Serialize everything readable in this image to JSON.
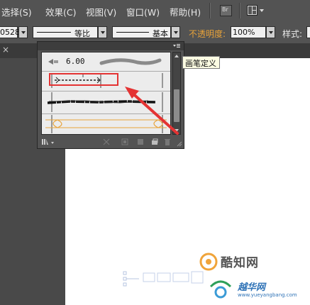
{
  "menubar": {
    "items": [
      "选择(S)",
      "效果(C)",
      "视图(V)",
      "窗口(W)",
      "帮助(H)"
    ],
    "br_label": "Br"
  },
  "toolbar": {
    "stroke_value": "0528",
    "profile_label": "等比",
    "brush_label": "基本",
    "opacity_label": "不透明度:",
    "opacity_value": "100%",
    "style_label": "样式:"
  },
  "brush_panel": {
    "size_value": "6.00",
    "tooltip": "画笔定义"
  },
  "watermark": {
    "brand": "酷知网",
    "sub_brand": "越华网",
    "url": "www.yueyangbang.com"
  },
  "colors": {
    "accent_orange": "#e8a33a",
    "highlight_red": "#e43333",
    "panel_bg": "#535353"
  }
}
